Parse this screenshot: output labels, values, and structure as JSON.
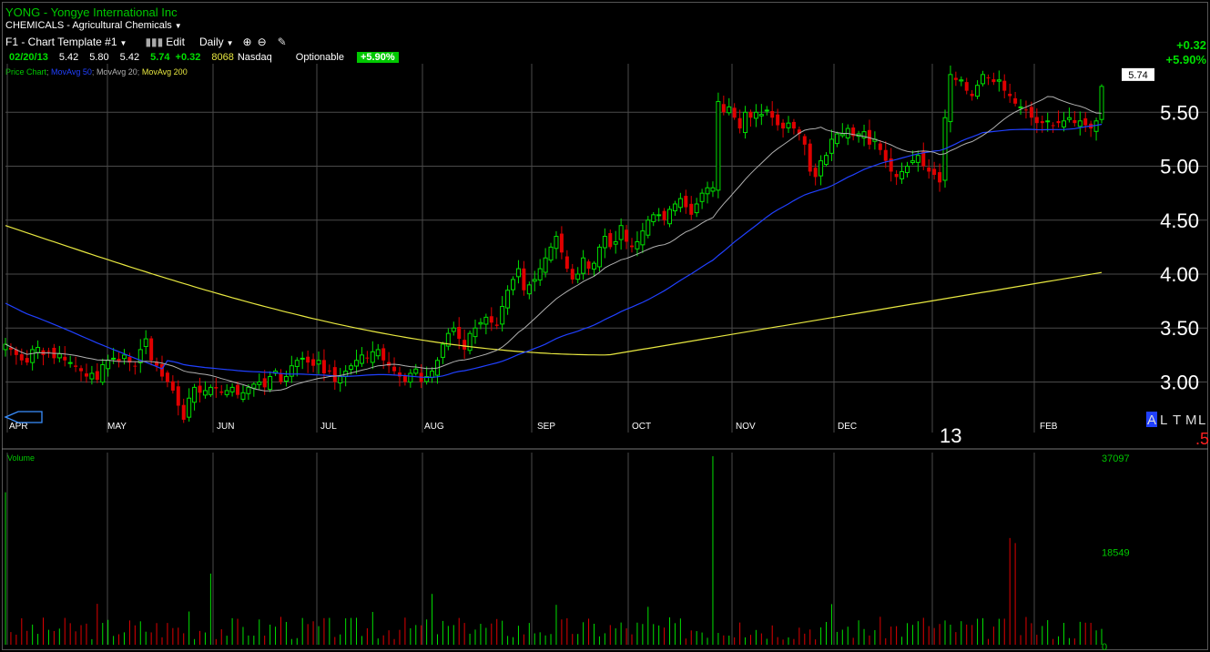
{
  "header": {
    "title": "YONG - Yongye International Inc",
    "industry": "CHEMICALS - Agricultural Chemicals",
    "template": "F1 - Chart Template #1",
    "edit": "Edit",
    "period": "Daily",
    "quote": {
      "date": "02/20/13",
      "open": "5.42",
      "high": "5.80",
      "low": "5.42",
      "close": "5.74",
      "change": "+0.32",
      "volume": "8068",
      "exchange": "Nasdaq",
      "optionable": "Optionable",
      "pct": "+5.90%"
    },
    "change_right": "+0.32",
    "pct_right": "+5.90%"
  },
  "legend": {
    "price_chart": "Price Chart",
    "ma50": "MovAvg 50",
    "ma20": "MovAvg 20",
    "ma200": "MovAvg 200"
  },
  "scale_modes": [
    "A",
    "L",
    "T",
    "M",
    "L"
  ],
  "red_fragment": ".5",
  "year_label": "13",
  "last_price_tag": "5.74",
  "colors": {
    "up": "#00e000",
    "down": "#e00000",
    "ma50": "#2040ff",
    "ma20": "#b0b0b0",
    "ma200": "#e8e840",
    "grid": "#4a4a4a"
  },
  "chart_data": [
    {
      "type": "candlestick",
      "title": "YONG Daily",
      "x": [
        "2012-04-02",
        "2012-04-03",
        "2012-04-04",
        "2012-04-05",
        "2012-04-09",
        "2012-04-10",
        "2012-04-11",
        "2012-04-12",
        "2012-04-13",
        "2012-04-16",
        "2012-04-17",
        "2012-04-18",
        "2012-04-19",
        "2012-04-20",
        "2012-04-23",
        "2012-04-24",
        "2012-04-25",
        "2012-04-26",
        "2012-04-27",
        "2012-04-30",
        "2012-05-01",
        "2012-05-02",
        "2012-05-03",
        "2012-05-04",
        "2012-05-07",
        "2012-05-08",
        "2012-05-09",
        "2012-05-10",
        "2012-05-11",
        "2012-05-14",
        "2012-05-15",
        "2012-05-16",
        "2012-05-17",
        "2012-05-18",
        "2012-05-21",
        "2012-05-22",
        "2012-05-23",
        "2012-05-24",
        "2012-05-25",
        "2012-05-29",
        "2012-05-30",
        "2012-05-31",
        "2012-06-01",
        "2012-06-04",
        "2012-06-05",
        "2012-06-06",
        "2012-06-07",
        "2012-06-08",
        "2012-06-11",
        "2012-06-12",
        "2012-06-13",
        "2012-06-14",
        "2012-06-15",
        "2012-06-18",
        "2012-06-19",
        "2012-06-20",
        "2012-06-21",
        "2012-06-22",
        "2012-06-25",
        "2012-06-26",
        "2012-06-27",
        "2012-06-28",
        "2012-06-29",
        "2012-07-02",
        "2012-07-03",
        "2012-07-05",
        "2012-07-06",
        "2012-07-09",
        "2012-07-10",
        "2012-07-11",
        "2012-07-12",
        "2012-07-13",
        "2012-07-16",
        "2012-07-17",
        "2012-07-18",
        "2012-07-19",
        "2012-07-20",
        "2012-07-23",
        "2012-07-24",
        "2012-07-25",
        "2012-07-26",
        "2012-07-27",
        "2012-07-30",
        "2012-07-31",
        "2012-08-01",
        "2012-08-02",
        "2012-08-03",
        "2012-08-06",
        "2012-08-07",
        "2012-08-08",
        "2012-08-09",
        "2012-08-10",
        "2012-08-13",
        "2012-08-14",
        "2012-08-15",
        "2012-08-16",
        "2012-08-17",
        "2012-08-20",
        "2012-08-21",
        "2012-08-22",
        "2012-08-23",
        "2012-08-24",
        "2012-08-27",
        "2012-08-28",
        "2012-08-29",
        "2012-08-30",
        "2012-08-31",
        "2012-09-04",
        "2012-09-05",
        "2012-09-06",
        "2012-09-07",
        "2012-09-10",
        "2012-09-11",
        "2012-09-12",
        "2012-09-13",
        "2012-09-14",
        "2012-09-17",
        "2012-09-18",
        "2012-09-19",
        "2012-09-20",
        "2012-09-21",
        "2012-09-24",
        "2012-09-25",
        "2012-09-26",
        "2012-09-27",
        "2012-09-28",
        "2012-10-01",
        "2012-10-02",
        "2012-10-03",
        "2012-10-04",
        "2012-10-05",
        "2012-10-08",
        "2012-10-09",
        "2012-10-10",
        "2012-10-11",
        "2012-10-12",
        "2012-10-15",
        "2012-10-16",
        "2012-10-17",
        "2012-10-18",
        "2012-10-19",
        "2012-10-22",
        "2012-10-23",
        "2012-10-24",
        "2012-10-25",
        "2012-10-26",
        "2012-10-31",
        "2012-11-01",
        "2012-11-02",
        "2012-11-05",
        "2012-11-06",
        "2012-11-07",
        "2012-11-08",
        "2012-11-09",
        "2012-11-12",
        "2012-11-13",
        "2012-11-14",
        "2012-11-15",
        "2012-11-16",
        "2012-11-19",
        "2012-11-20",
        "2012-11-21",
        "2012-11-23",
        "2012-11-26",
        "2012-11-27",
        "2012-11-28",
        "2012-11-29",
        "2012-11-30",
        "2012-12-03",
        "2012-12-04",
        "2012-12-05",
        "2012-12-06",
        "2012-12-07",
        "2012-12-10",
        "2012-12-11",
        "2012-12-12",
        "2012-12-13",
        "2012-12-14",
        "2012-12-17",
        "2012-12-18",
        "2012-12-19",
        "2012-12-20",
        "2012-12-21",
        "2012-12-24",
        "2012-12-26",
        "2012-12-27",
        "2012-12-28",
        "2012-12-31",
        "2013-01-02",
        "2013-01-03",
        "2013-01-04",
        "2013-01-07",
        "2013-01-08",
        "2013-01-09",
        "2013-01-10",
        "2013-01-11",
        "2013-01-14",
        "2013-01-15",
        "2013-01-16",
        "2013-01-17",
        "2013-01-18",
        "2013-01-22",
        "2013-01-23",
        "2013-01-24",
        "2013-01-25",
        "2013-01-28",
        "2013-01-29",
        "2013-01-30",
        "2013-01-31",
        "2013-02-01",
        "2013-02-04",
        "2013-02-05",
        "2013-02-06",
        "2013-02-07",
        "2013-02-08",
        "2013-02-11",
        "2013-02-12",
        "2013-02-13",
        "2013-02-14",
        "2013-02-15",
        "2013-02-19",
        "2013-02-20"
      ],
      "close": [
        3.35,
        3.3,
        3.25,
        3.2,
        3.18,
        3.3,
        3.32,
        3.25,
        3.28,
        3.22,
        3.26,
        3.2,
        3.18,
        3.14,
        3.1,
        3.05,
        3.08,
        3.02,
        3.16,
        3.2,
        3.22,
        3.19,
        3.25,
        3.18,
        3.15,
        3.3,
        3.4,
        3.2,
        3.15,
        3.05,
        3.0,
        2.92,
        2.78,
        2.65,
        2.85,
        2.95,
        2.9,
        2.92,
        2.95,
        2.94,
        2.9,
        2.92,
        2.95,
        2.88,
        2.9,
        2.95,
        2.98,
        3.0,
        2.95,
        3.05,
        3.1,
        3.0,
        3.05,
        3.15,
        3.2,
        3.22,
        3.18,
        3.15,
        3.2,
        3.08,
        3.1,
        3.0,
        3.05,
        3.1,
        3.15,
        3.2,
        3.25,
        3.22,
        3.28,
        3.3,
        3.2,
        3.15,
        3.1,
        3.05,
        3.0,
        3.08,
        3.12,
        3.0,
        3.05,
        3.1,
        3.2,
        3.35,
        3.45,
        3.5,
        3.4,
        3.3,
        3.45,
        3.5,
        3.55,
        3.6,
        3.55,
        3.52,
        3.7,
        3.85,
        3.95,
        4.05,
        3.85,
        3.9,
        3.95,
        4.05,
        4.15,
        4.25,
        4.35,
        4.2,
        4.05,
        3.95,
        4.0,
        4.15,
        4.05,
        4.1,
        4.25,
        4.35,
        4.25,
        4.3,
        4.45,
        4.3,
        4.25,
        4.3,
        4.4,
        4.5,
        4.55,
        4.55,
        4.5,
        4.6,
        4.65,
        4.7,
        4.62,
        4.55,
        4.65,
        4.75,
        4.8,
        4.8,
        5.6,
        5.5,
        5.55,
        5.45,
        5.35,
        5.5,
        5.45,
        5.5,
        5.48,
        5.52,
        5.45,
        5.38,
        5.35,
        5.4,
        5.35,
        5.3,
        5.2,
        4.95,
        4.9,
        5.05,
        5.1,
        5.25,
        5.3,
        5.3,
        5.35,
        5.28,
        5.3,
        5.32,
        5.2,
        5.25,
        5.15,
        5.05,
        4.95,
        4.9,
        4.95,
        5.0,
        5.05,
        5.1,
        5.0,
        4.95,
        4.92,
        4.85,
        5.45,
        5.85,
        5.8,
        5.8,
        5.7,
        5.65,
        5.75,
        5.85,
        5.82,
        5.78,
        5.8,
        5.7,
        5.65,
        5.58,
        5.55,
        5.52,
        5.45,
        5.4,
        5.4,
        5.42,
        5.38,
        5.4,
        5.42,
        5.45,
        5.4,
        5.42,
        5.38,
        5.35,
        5.42,
        5.74
      ],
      "ylabel": "",
      "ylim": [
        2.7,
        5.95
      ],
      "yticks": [
        "3.00",
        "3.50",
        "4.00",
        "4.50",
        "5.00",
        "5.50"
      ],
      "months": [
        "APR",
        "MAY",
        "JUN",
        "JUL",
        "AUG",
        "SEP",
        "OCT",
        "NOV",
        "DEC",
        "FEB"
      ],
      "series": [
        {
          "name": "MovAvg 50",
          "type": "line"
        },
        {
          "name": "MovAvg 20",
          "type": "line"
        },
        {
          "name": "MovAvg 200",
          "type": "line"
        }
      ]
    },
    {
      "type": "bar",
      "title": "Volume",
      "yticks": [
        "37097",
        "18549",
        "0"
      ],
      "ylim": [
        0,
        37097
      ]
    }
  ]
}
